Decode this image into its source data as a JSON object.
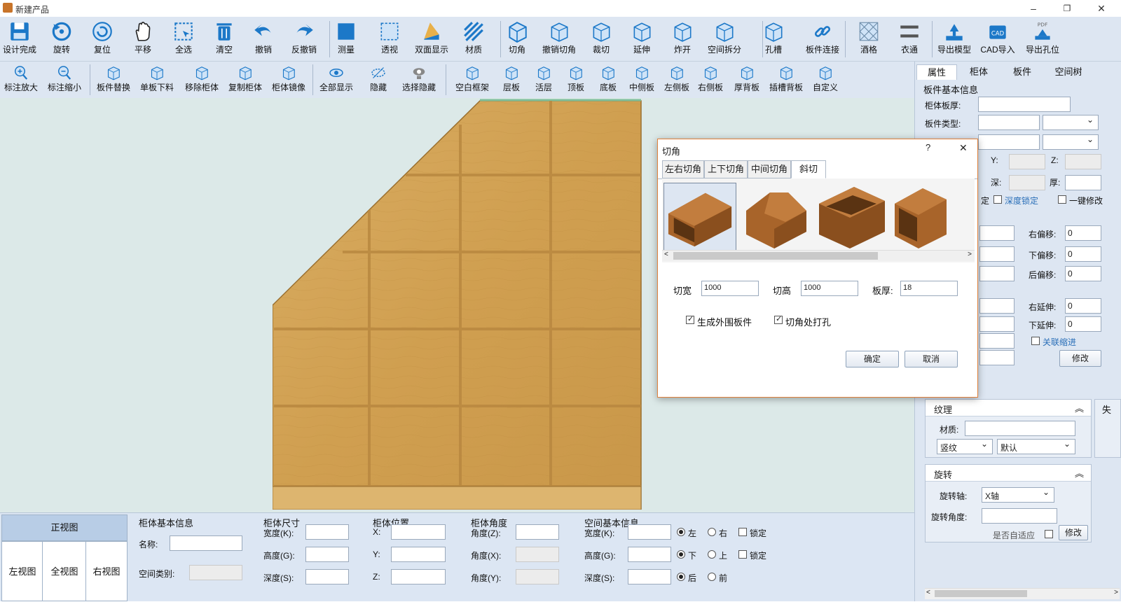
{
  "app": {
    "title": "新建产品",
    "min": "–",
    "max": "❐",
    "close": "✕"
  },
  "toolbar1": [
    {
      "name": "design-done",
      "label": "设计完成",
      "icon": "save-icon"
    },
    {
      "name": "rotate",
      "label": "旋转",
      "icon": "rotate-icon"
    },
    {
      "name": "reset",
      "label": "复位",
      "icon": "reset-icon"
    },
    {
      "name": "pan",
      "label": "平移",
      "icon": "hand-icon"
    },
    {
      "name": "select-all",
      "label": "全选",
      "icon": "select-icon"
    },
    {
      "name": "clear",
      "label": "清空",
      "icon": "trash-icon"
    },
    {
      "name": "undo",
      "label": "撤销",
      "icon": "undo-icon"
    },
    {
      "name": "redo",
      "label": "反撤销",
      "icon": "redo-icon"
    },
    {
      "name": "measure",
      "label": "测量",
      "icon": "measure-icon"
    },
    {
      "name": "perspective",
      "label": "透视",
      "icon": "perspective-icon"
    },
    {
      "name": "double-side",
      "label": "双面显示",
      "icon": "double-side-icon"
    },
    {
      "name": "material",
      "label": "材质",
      "icon": "material-icon"
    },
    {
      "name": "chamfer",
      "label": "切角",
      "icon": "chamfer-icon"
    },
    {
      "name": "undo-chamfer",
      "label": "撤销切角",
      "icon": "undo-chamfer-icon"
    },
    {
      "name": "cut",
      "label": "裁切",
      "icon": "cut-icon"
    },
    {
      "name": "extend",
      "label": "延伸",
      "icon": "extend-icon"
    },
    {
      "name": "explode",
      "label": "炸开",
      "icon": "explode-icon"
    },
    {
      "name": "space-split",
      "label": "空间拆分",
      "icon": "space-split-icon"
    },
    {
      "name": "slot",
      "label": "孔槽",
      "icon": "slot-icon"
    },
    {
      "name": "board-connect",
      "label": "板件连接",
      "icon": "link-icon"
    },
    {
      "name": "wine-grid",
      "label": "酒格",
      "icon": "grid-icon"
    },
    {
      "name": "clothes-rail",
      "label": "衣通",
      "icon": "rail-icon"
    },
    {
      "name": "export-model",
      "label": "导出模型",
      "icon": "export-icon"
    },
    {
      "name": "cad-import",
      "label": "CAD导入",
      "icon": "cad-icon"
    },
    {
      "name": "export-holes",
      "label": "导出孔位",
      "icon": "pdf-icon"
    }
  ],
  "toolbar2": [
    {
      "name": "mark-zoom-in",
      "label": "标注放大",
      "icon": "zoom-in-icon"
    },
    {
      "name": "mark-zoom-out",
      "label": "标注缩小",
      "icon": "zoom-out-icon"
    },
    {
      "name": "board-replace",
      "label": "板件替换",
      "icon": "cad-replace-icon"
    },
    {
      "name": "single-board",
      "label": "单板下料",
      "icon": "board-icon"
    },
    {
      "name": "remove-cabinet",
      "label": "移除柜体",
      "icon": "remove-cabinet-icon"
    },
    {
      "name": "copy-cabinet",
      "label": "复制柜体",
      "icon": "copy-cabinet-icon"
    },
    {
      "name": "mirror-cabinet",
      "label": "柜体镜像",
      "icon": "mirror-icon"
    },
    {
      "name": "show-all",
      "label": "全部显示",
      "icon": "eye-icon"
    },
    {
      "name": "hide",
      "label": "隐藏",
      "icon": "eye-hidden-icon"
    },
    {
      "name": "select-hide",
      "label": "选择隐藏",
      "icon": "select-hide-icon"
    },
    {
      "name": "empty-frame",
      "label": "空白框架",
      "icon": "frame-icon"
    },
    {
      "name": "shelf",
      "label": "层板",
      "icon": "shelf-icon"
    },
    {
      "name": "movable-shelf",
      "label": "活层",
      "icon": "movable-shelf-icon"
    },
    {
      "name": "top-board",
      "label": "顶板",
      "icon": "top-board-icon"
    },
    {
      "name": "bottom-board",
      "label": "底板",
      "icon": "bottom-board-icon"
    },
    {
      "name": "middle-side",
      "label": "中侧板",
      "icon": "middle-side-icon"
    },
    {
      "name": "left-side",
      "label": "左侧板",
      "icon": "left-side-icon"
    },
    {
      "name": "right-side",
      "label": "右侧板",
      "icon": "right-side-icon"
    },
    {
      "name": "thick-back",
      "label": "厚背板",
      "icon": "thick-back-icon"
    },
    {
      "name": "slot-back",
      "label": "插槽背板",
      "icon": "slot-back-icon"
    },
    {
      "name": "custom",
      "label": "自定义",
      "icon": "custom-icon"
    }
  ],
  "views": {
    "front": "正视图",
    "left": "左视图",
    "all": "全视图",
    "right": "右视图"
  },
  "cabinet_info": {
    "title": "柜体基本信息",
    "name_label": "名称:",
    "type_label": "空间类别:",
    "name_value": "",
    "type_value": ""
  },
  "cabinet_size": {
    "title": "柜体尺寸",
    "w": "宽度(K):",
    "h": "高度(G):",
    "d": "深度(S):"
  },
  "cabinet_pos": {
    "title": "柜体位置",
    "x": "X:",
    "y": "Y:",
    "z": "Z:"
  },
  "cabinet_angle": {
    "title": "柜体角度",
    "z": "角度(Z):",
    "x": "角度(X):",
    "y": "角度(Y):"
  },
  "space_info": {
    "title": "空间基本信息",
    "w": "宽度(K):",
    "h": "高度(G):",
    "d": "深度(S):",
    "left": "左",
    "right": "右",
    "down": "下",
    "up": "上",
    "back": "后",
    "front": "前",
    "lock": "锁定"
  },
  "right_panel": {
    "tabs": [
      "属性",
      "柜体",
      "板件",
      "空间树"
    ],
    "board_info_title": "板件基本信息",
    "thickness_label": "柜体板厚:",
    "type_label": "板件类型:",
    "y_label": "Y:",
    "z_label": "Z:",
    "depth_label": "深:",
    "thick_label": "厚:",
    "lock_depth": "深度锁定",
    "one_key": "一键修改",
    "right_offset": "右偏移:",
    "down_offset": "下偏移:",
    "back_offset": "后偏移:",
    "right_offset_val": "0",
    "down_offset_val": "0",
    "back_offset_val": "0",
    "right_ext": "右延伸:",
    "down_ext": "下延伸:",
    "right_ext_val": "0",
    "down_ext_val": "0",
    "link_shrink": "关联缩进",
    "modify": "修改",
    "texture_title": "纹理",
    "material_label": "材质:",
    "grain": "竖纹",
    "default": "默认",
    "rotate_title": "旋转",
    "axis_label": "旋转轴:",
    "axis_value": "X轴",
    "angle_label": "旋转角度:",
    "adapt_label": "是否自适应",
    "modify2": "修改",
    "partial_label": "失",
    "partial_end": "定"
  },
  "dialog": {
    "title": "切角",
    "help": "?",
    "close": "✕",
    "tabs": [
      "左右切角",
      "上下切角",
      "中间切角",
      "斜切"
    ],
    "width_label": "切宽",
    "width_val": "1000",
    "height_label": "切高",
    "height_val": "1000",
    "thick_label": "板厚:",
    "thick_val": "18",
    "gen_outer": "生成外围板件",
    "drill": "切角处打孔",
    "ok": "确定",
    "cancel": "取消"
  },
  "colors": {
    "toolbar": "#dde6f2",
    "canvas": "#dce9e8",
    "accent_blue": "#1c78c8",
    "wood": "#d6a85c"
  }
}
